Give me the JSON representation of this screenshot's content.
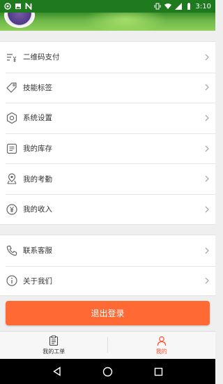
{
  "status_bar": {
    "time": "3:10",
    "left_icons": [
      "app-notification-icon",
      "image-notification-icon",
      "n-notification-icon"
    ],
    "right_icons": [
      "vibrate-icon",
      "wifi-icon",
      "signal-icon",
      "battery-icon"
    ]
  },
  "menu_group_1": {
    "items": [
      {
        "label": "二维码支付",
        "icon": "qr-payment-icon"
      },
      {
        "label": "技能标签",
        "icon": "tag-icon"
      },
      {
        "label": "系统设置",
        "icon": "gear-icon"
      },
      {
        "label": "我的库存",
        "icon": "inventory-icon"
      },
      {
        "label": "我的考勤",
        "icon": "location-icon"
      },
      {
        "label": "我的收入",
        "icon": "income-icon"
      }
    ]
  },
  "menu_group_2": {
    "items": [
      {
        "label": "联系客服",
        "icon": "phone-icon"
      },
      {
        "label": "关于我们",
        "icon": "info-icon"
      }
    ]
  },
  "logout_label": "退出登录",
  "tabs": [
    {
      "label": "我的工单",
      "icon": "work-order-icon",
      "active": false
    },
    {
      "label": "我的",
      "icon": "user-icon",
      "active": true
    }
  ],
  "colors": {
    "accent": "#ff6a34",
    "active_tab": "#ff4d2a",
    "status_bar": "#1f7a1f"
  }
}
